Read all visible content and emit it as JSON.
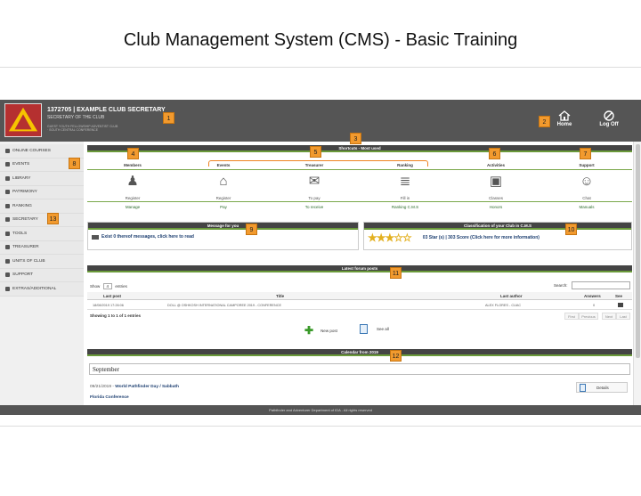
{
  "slide": {
    "title": "Club Management System (CMS) - Basic Training"
  },
  "header": {
    "club_name": "1372705 | EXAMPLE CLUB SECRETARY",
    "role": "SECRETARY OF THE CLUB",
    "sub": "GUEST YOUTH FELLOWSHIP ADVENTIST CLUB · SOUTH CENTRAL CONFERENCE",
    "home_label": "Home",
    "logoff_label": "Log Off"
  },
  "badges": [
    "1",
    "2",
    "3",
    "4",
    "5",
    "6",
    "7",
    "8",
    "9",
    "10",
    "11",
    "12",
    "13"
  ],
  "sidebar": {
    "items": [
      {
        "label": "ONLINE COURSES",
        "icon": "monitor-icon"
      },
      {
        "label": "EVENTS",
        "icon": "list-icon"
      },
      {
        "label": "LIBRARY",
        "icon": "book-icon"
      },
      {
        "label": "PATRIMONY",
        "icon": "building-icon"
      },
      {
        "label": "RANKING",
        "icon": "trophy-icon"
      },
      {
        "label": "SECRETARY",
        "icon": "folder-icon"
      },
      {
        "label": "TOOLS",
        "icon": "wrench-icon"
      },
      {
        "label": "TREASURER",
        "icon": "money-icon"
      },
      {
        "label": "UNITS OF CLUB",
        "icon": "people-icon"
      },
      {
        "label": "SUPPORT",
        "icon": "support-icon"
      },
      {
        "label": "EXTRAS/ADDITIONAL",
        "icon": "tools-icon"
      }
    ]
  },
  "shortcuts": {
    "title": "Shortcuts - Most used",
    "categories": [
      "Members",
      "Events",
      "Treasurer",
      "Ranking",
      "Activities",
      "Support"
    ],
    "cells": [
      {
        "top": "Register",
        "bottom": "Manage",
        "icon": "add-user-icon",
        "glyph": "♟"
      },
      {
        "top": "Register",
        "bottom": "Pay",
        "icon": "cart-icon",
        "glyph": "⌂"
      },
      {
        "top": "To pay",
        "bottom": "To receive",
        "icon": "invoice-icon",
        "glyph": "✉"
      },
      {
        "top": "Fill in",
        "bottom": "Ranking C.M.S",
        "icon": "document-icon",
        "glyph": "≣"
      },
      {
        "top": "Classes",
        "bottom": "Honors",
        "icon": "id-card-icon",
        "glyph": "▣"
      },
      {
        "top": "Chat",
        "bottom": "Manuals",
        "icon": "support-agent-icon",
        "glyph": "☺"
      }
    ]
  },
  "message": {
    "title": "Message for you",
    "text": "Exist 0 thereof messages, click here to read"
  },
  "classification": {
    "title": "Classification of your Club in C.M.S",
    "stars": "★★★☆☆",
    "text": "03 Star (s) | 303 Score (Click here for more information)"
  },
  "forum": {
    "title": "Latest forum posts",
    "show_label": "Show",
    "show_value": "4",
    "entries_label": "entries",
    "search_label": "Search:",
    "columns": [
      "Last post",
      "Title",
      "Last author",
      "Answers",
      "See"
    ],
    "rows": [
      {
        "date": "18/08/2019 17:26:06",
        "title": "DOLL @ OSHKOSH INTERNATIONAL CAMPOREE 2019 - CONFERENCE",
        "author": "ALEX FLORES - CUAC",
        "answers": "0"
      }
    ],
    "showing": "Showing 1 to 1 of 1 entries",
    "pager": [
      "First",
      "Previous",
      "Next",
      "Last"
    ],
    "new_post": "New post",
    "see_all": "See all"
  },
  "calendar": {
    "title": "Calendar from 2019",
    "month": "September",
    "event_date": "09/21/2019 -",
    "event_title": "World Pathfinder Day / Sabbath",
    "event_org": "Florida Conference",
    "details": "Details"
  },
  "footer": {
    "text": "Pathfinder and Adventurer Department of IDA - All rights reserved"
  },
  "colors": {
    "badge": "#f29a2e",
    "topbar": "#555555",
    "accent_green": "#7aa84a",
    "bracket": "#ef8220"
  }
}
